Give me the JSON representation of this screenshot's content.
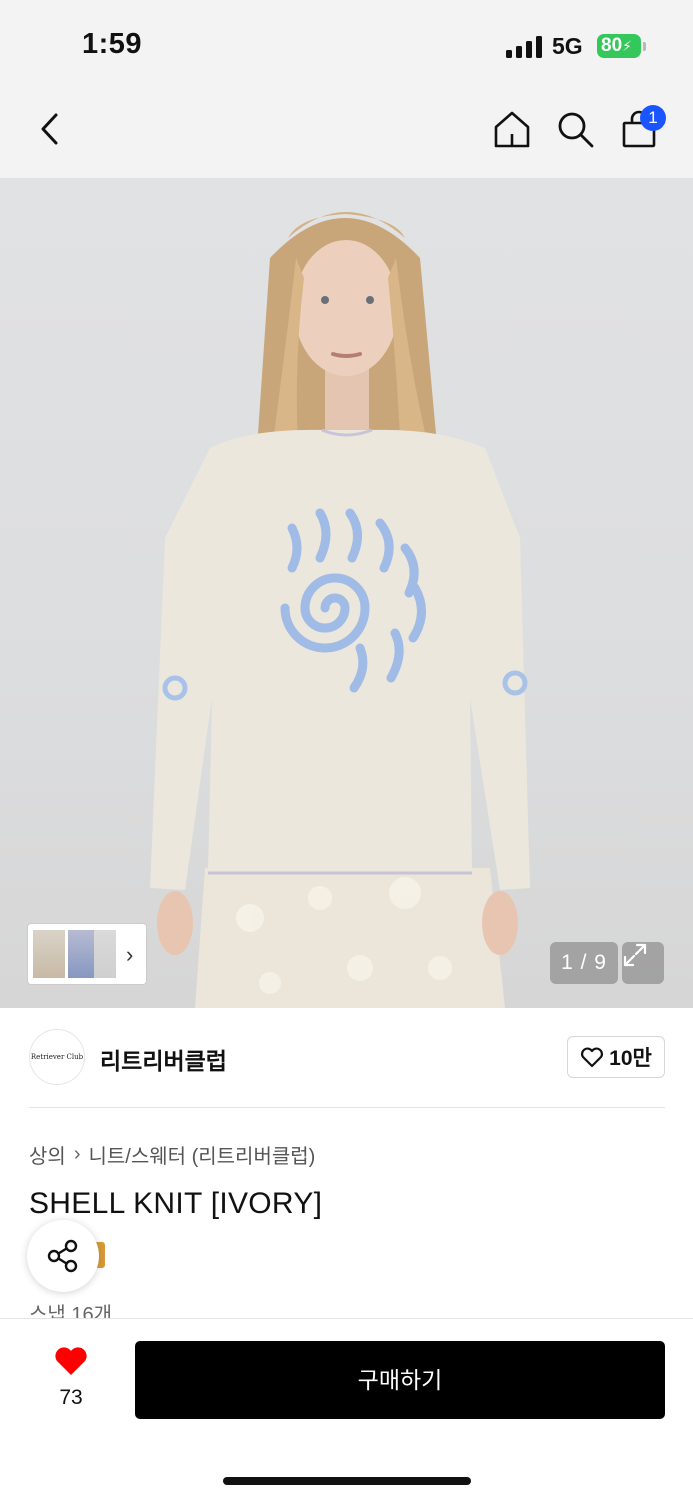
{
  "status_bar": {
    "time": "1:59",
    "network": "5G",
    "battery": "80",
    "battery_color": "#34c759"
  },
  "nav": {
    "back_icon": "chevron-left-icon",
    "home_icon": "home-icon",
    "search_icon": "search-icon",
    "cart_icon": "shopping-bag-icon",
    "cart_count": "1",
    "badge_color": "#1a56ff"
  },
  "gallery": {
    "counter": "1 / 9",
    "expand_icon": "expand-icon",
    "thumbnail_chevron": "›"
  },
  "brand": {
    "name": "리트리버클럽",
    "logo_text": "Retriever Club",
    "likes": "10만"
  },
  "product": {
    "breadcrumb": [
      "상의",
      "니트/스웨터 (리트리버클럽)"
    ],
    "breadcrumb_sep": "›",
    "title": "SHELL KNIT [IVORY]",
    "snaps": "스냅 16개",
    "share_icon": "share-icon"
  },
  "bottom_bar": {
    "wish_count": "73",
    "wish_color": "#ff0000",
    "buy_label": "구매하기"
  }
}
